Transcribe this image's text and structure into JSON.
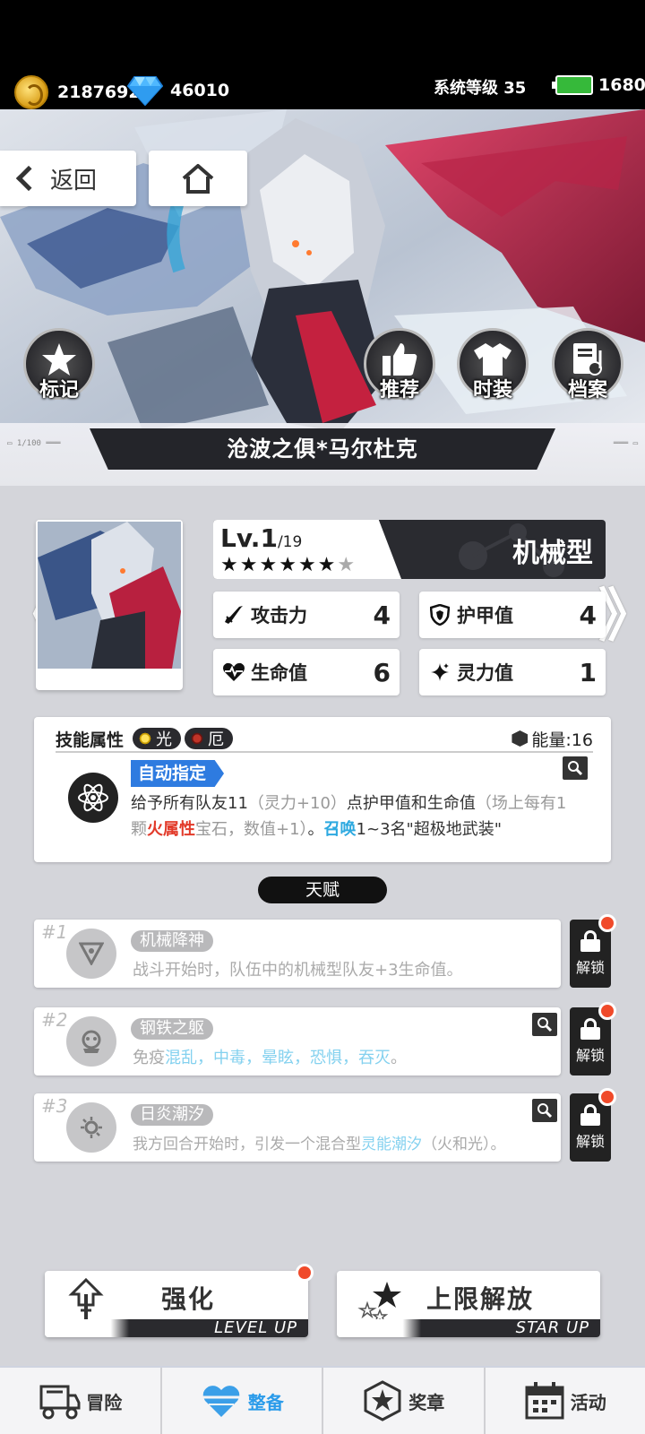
{
  "status": {
    "gold": "2187692",
    "diamond": "46010",
    "system_level": "系统等级 35",
    "energy": "1680"
  },
  "nav": {
    "back_label": "返回"
  },
  "hero_actions": [
    {
      "label": "标记",
      "icon": "star-icon"
    },
    {
      "label": "推荐",
      "icon": "thumbs-up-icon"
    },
    {
      "label": "时装",
      "icon": "shirt-icon"
    },
    {
      "label": "档案",
      "icon": "archive-icon"
    }
  ],
  "character": {
    "name": "沧波之俱*马尔杜克",
    "level": "Lv.1",
    "level_max": "/19",
    "stars_filled": 6,
    "stars_total": 7,
    "type": "机械型",
    "stats": {
      "attack": {
        "label": "攻击力",
        "value": "4"
      },
      "armor": {
        "label": "护甲值",
        "value": "4"
      },
      "hp": {
        "label": "生命值",
        "value": "6"
      },
      "spirit": {
        "label": "灵力值",
        "value": "1"
      }
    }
  },
  "skill": {
    "title": "技能属性",
    "elements": [
      "光",
      "厄"
    ],
    "energy": "能量:16",
    "tag": "自动指定",
    "desc": {
      "p1": "给予所有队友11",
      "p2": "（灵力+10）",
      "p3": "点护甲值和生命值",
      "p4": "（场上每有1颗",
      "p5": "火属性",
      "p6": "宝石，数值+1）",
      "p7": "。",
      "p8": "召唤",
      "p9": "1~3名\"超极地武装\""
    }
  },
  "talents": {
    "title": "天赋",
    "items": [
      {
        "num": "#1",
        "name": "机械降神",
        "desc": "战斗开始时，队伍中的机械型队友+3生命值。",
        "unlock": "解锁"
      },
      {
        "num": "#2",
        "name": "钢铁之躯",
        "desc_a": "免疫",
        "desc_b": "混乱，中毒，晕眩，恐惧，吞灭",
        "desc_c": "。",
        "unlock": "解锁"
      },
      {
        "num": "#3",
        "name": "日炎潮汐",
        "desc_a": "我方回合开始时，引发一个混合型",
        "desc_b": "灵能潮汐",
        "desc_c": "（火和光）。",
        "unlock": "解锁"
      }
    ]
  },
  "actions": {
    "enhance": {
      "label": "强化",
      "sub": "LEVEL UP"
    },
    "limit": {
      "label": "上限解放",
      "sub": "STAR UP"
    }
  },
  "bottom_nav": [
    {
      "label": "冒险",
      "icon": "truck-icon"
    },
    {
      "label": "整备",
      "icon": "heart-gear-icon",
      "active": true
    },
    {
      "label": "奖章",
      "icon": "medal-icon"
    },
    {
      "label": "活动",
      "icon": "calendar-icon"
    }
  ],
  "colors": {
    "accent_blue": "#2e7be0",
    "fire_red": "#e23a2a",
    "summon_cyan": "#2da9e0",
    "nav_active": "#2a9bea"
  }
}
